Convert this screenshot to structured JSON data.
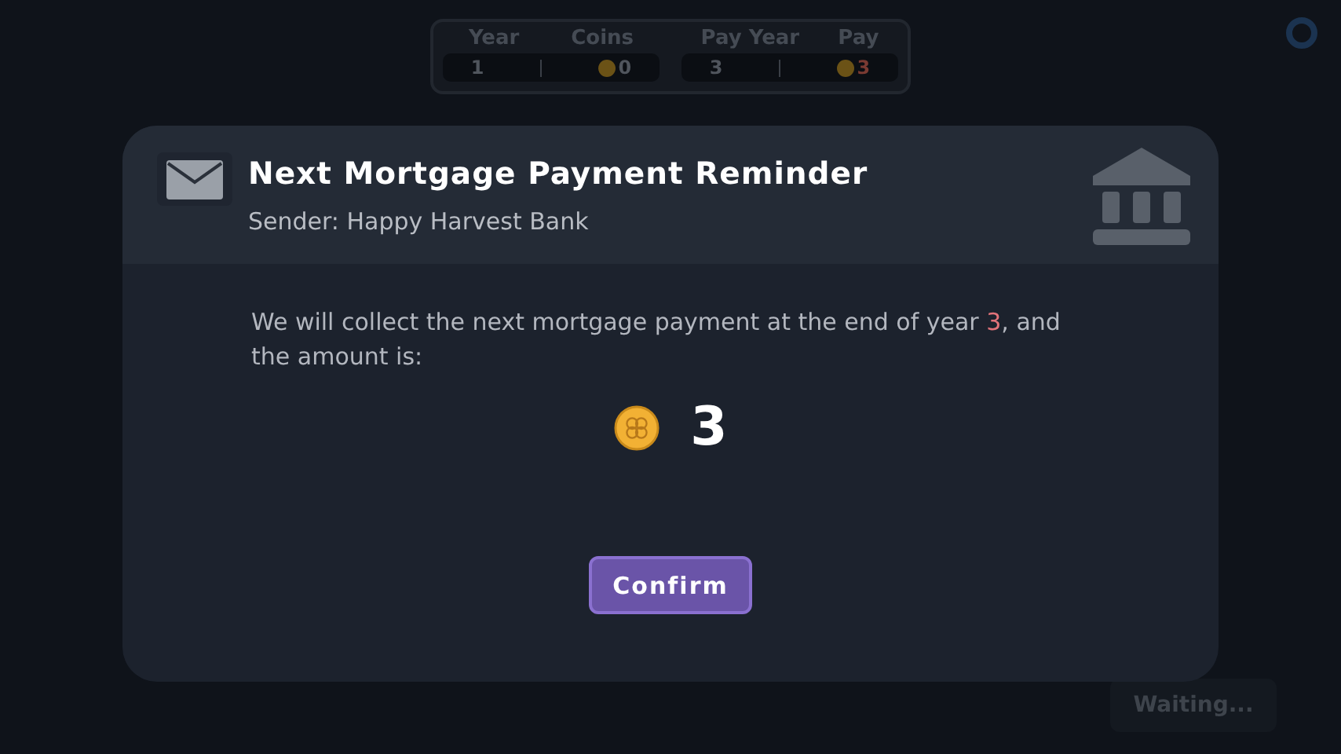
{
  "status_panel": {
    "groups": [
      {
        "headers": [
          "Year",
          "Coins"
        ],
        "values": [
          {
            "text": "1",
            "coin": false,
            "alert": false
          },
          {
            "text": "0",
            "coin": true,
            "alert": false
          }
        ]
      },
      {
        "headers": [
          "Pay Year",
          "Pay"
        ],
        "values": [
          {
            "text": "3",
            "coin": false,
            "alert": false
          },
          {
            "text": "3",
            "coin": true,
            "alert": true
          }
        ]
      }
    ]
  },
  "waiting_button": {
    "label": "Waiting..."
  },
  "dialog": {
    "title": "Next Mortgage Payment Reminder",
    "sender": "Sender: Happy Harvest Bank",
    "message": {
      "before": "We will collect the next mortgage payment at the end of year ",
      "highlight": "3",
      "after": ", and the amount is:"
    },
    "amount": "3",
    "confirm": {
      "label": "Confirm"
    }
  }
}
